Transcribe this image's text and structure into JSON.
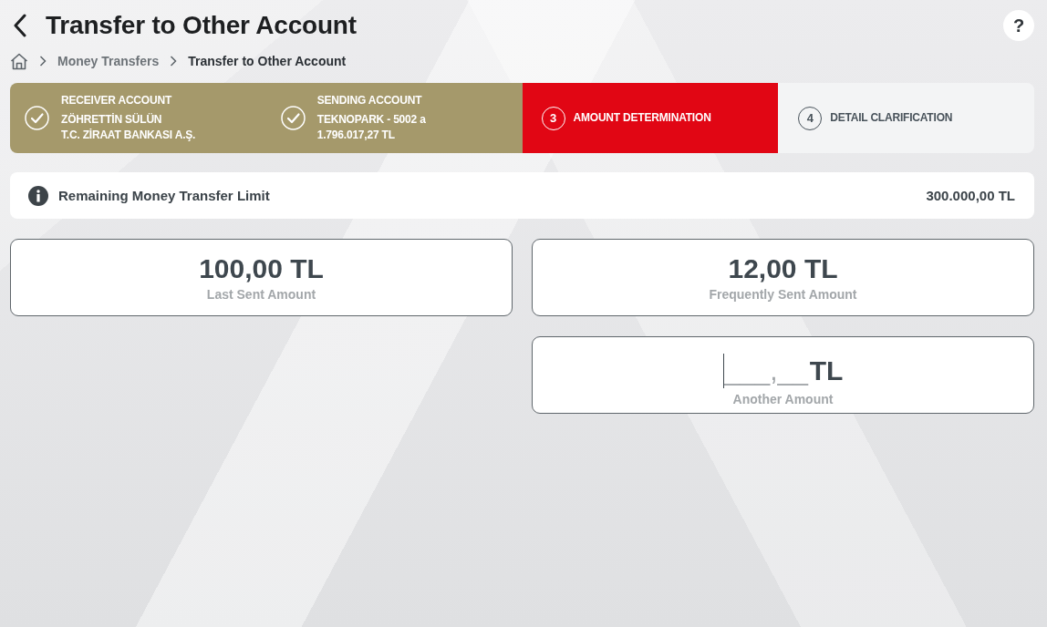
{
  "header": {
    "title": "Transfer to Other Account",
    "help": "?"
  },
  "breadcrumb": [
    {
      "label": "Money Transfers",
      "current": false
    },
    {
      "label": "Transfer to Other Account",
      "current": true
    }
  ],
  "steps": [
    {
      "kind": "completed",
      "title": "RECEIVER ACCOUNT",
      "details": [
        "ZÖHRETTİN SÜLÜN",
        "T.C. ZİRAAT BANKASI A.Ş."
      ]
    },
    {
      "kind": "completed",
      "title": "SENDING ACCOUNT",
      "details": [
        "TEKNOPARK - 5002 a",
        "1.796.017,27 TL"
      ]
    },
    {
      "kind": "current",
      "number": "3",
      "title": "AMOUNT DETERMINATION"
    },
    {
      "kind": "upcoming",
      "number": "4",
      "title": "DETAIL CLARIFICATION"
    }
  ],
  "limit": {
    "label": "Remaining Money Transfer Limit",
    "value": "300.000,00 TL"
  },
  "amount_options": [
    {
      "amount": "100,00 TL",
      "label": "Last Sent Amount",
      "selected": false
    },
    {
      "amount": "12,00 TL",
      "label": "Frequently Sent Amount",
      "selected": false
    }
  ],
  "another_amount": {
    "placeholder": "___,__",
    "currency": "TL",
    "label": "Another Amount"
  }
}
